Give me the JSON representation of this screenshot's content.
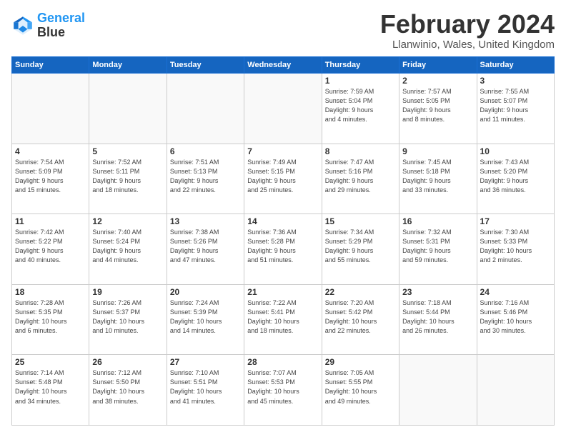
{
  "logo": {
    "line1": "General",
    "line2": "Blue"
  },
  "title": "February 2024",
  "location": "Llanwinio, Wales, United Kingdom",
  "days_of_week": [
    "Sunday",
    "Monday",
    "Tuesday",
    "Wednesday",
    "Thursday",
    "Friday",
    "Saturday"
  ],
  "weeks": [
    [
      {
        "day": "",
        "info": ""
      },
      {
        "day": "",
        "info": ""
      },
      {
        "day": "",
        "info": ""
      },
      {
        "day": "",
        "info": ""
      },
      {
        "day": "1",
        "info": "Sunrise: 7:59 AM\nSunset: 5:04 PM\nDaylight: 9 hours\nand 4 minutes."
      },
      {
        "day": "2",
        "info": "Sunrise: 7:57 AM\nSunset: 5:05 PM\nDaylight: 9 hours\nand 8 minutes."
      },
      {
        "day": "3",
        "info": "Sunrise: 7:55 AM\nSunset: 5:07 PM\nDaylight: 9 hours\nand 11 minutes."
      }
    ],
    [
      {
        "day": "4",
        "info": "Sunrise: 7:54 AM\nSunset: 5:09 PM\nDaylight: 9 hours\nand 15 minutes."
      },
      {
        "day": "5",
        "info": "Sunrise: 7:52 AM\nSunset: 5:11 PM\nDaylight: 9 hours\nand 18 minutes."
      },
      {
        "day": "6",
        "info": "Sunrise: 7:51 AM\nSunset: 5:13 PM\nDaylight: 9 hours\nand 22 minutes."
      },
      {
        "day": "7",
        "info": "Sunrise: 7:49 AM\nSunset: 5:15 PM\nDaylight: 9 hours\nand 25 minutes."
      },
      {
        "day": "8",
        "info": "Sunrise: 7:47 AM\nSunset: 5:16 PM\nDaylight: 9 hours\nand 29 minutes."
      },
      {
        "day": "9",
        "info": "Sunrise: 7:45 AM\nSunset: 5:18 PM\nDaylight: 9 hours\nand 33 minutes."
      },
      {
        "day": "10",
        "info": "Sunrise: 7:43 AM\nSunset: 5:20 PM\nDaylight: 9 hours\nand 36 minutes."
      }
    ],
    [
      {
        "day": "11",
        "info": "Sunrise: 7:42 AM\nSunset: 5:22 PM\nDaylight: 9 hours\nand 40 minutes."
      },
      {
        "day": "12",
        "info": "Sunrise: 7:40 AM\nSunset: 5:24 PM\nDaylight: 9 hours\nand 44 minutes."
      },
      {
        "day": "13",
        "info": "Sunrise: 7:38 AM\nSunset: 5:26 PM\nDaylight: 9 hours\nand 47 minutes."
      },
      {
        "day": "14",
        "info": "Sunrise: 7:36 AM\nSunset: 5:28 PM\nDaylight: 9 hours\nand 51 minutes."
      },
      {
        "day": "15",
        "info": "Sunrise: 7:34 AM\nSunset: 5:29 PM\nDaylight: 9 hours\nand 55 minutes."
      },
      {
        "day": "16",
        "info": "Sunrise: 7:32 AM\nSunset: 5:31 PM\nDaylight: 9 hours\nand 59 minutes."
      },
      {
        "day": "17",
        "info": "Sunrise: 7:30 AM\nSunset: 5:33 PM\nDaylight: 10 hours\nand 2 minutes."
      }
    ],
    [
      {
        "day": "18",
        "info": "Sunrise: 7:28 AM\nSunset: 5:35 PM\nDaylight: 10 hours\nand 6 minutes."
      },
      {
        "day": "19",
        "info": "Sunrise: 7:26 AM\nSunset: 5:37 PM\nDaylight: 10 hours\nand 10 minutes."
      },
      {
        "day": "20",
        "info": "Sunrise: 7:24 AM\nSunset: 5:39 PM\nDaylight: 10 hours\nand 14 minutes."
      },
      {
        "day": "21",
        "info": "Sunrise: 7:22 AM\nSunset: 5:41 PM\nDaylight: 10 hours\nand 18 minutes."
      },
      {
        "day": "22",
        "info": "Sunrise: 7:20 AM\nSunset: 5:42 PM\nDaylight: 10 hours\nand 22 minutes."
      },
      {
        "day": "23",
        "info": "Sunrise: 7:18 AM\nSunset: 5:44 PM\nDaylight: 10 hours\nand 26 minutes."
      },
      {
        "day": "24",
        "info": "Sunrise: 7:16 AM\nSunset: 5:46 PM\nDaylight: 10 hours\nand 30 minutes."
      }
    ],
    [
      {
        "day": "25",
        "info": "Sunrise: 7:14 AM\nSunset: 5:48 PM\nDaylight: 10 hours\nand 34 minutes."
      },
      {
        "day": "26",
        "info": "Sunrise: 7:12 AM\nSunset: 5:50 PM\nDaylight: 10 hours\nand 38 minutes."
      },
      {
        "day": "27",
        "info": "Sunrise: 7:10 AM\nSunset: 5:51 PM\nDaylight: 10 hours\nand 41 minutes."
      },
      {
        "day": "28",
        "info": "Sunrise: 7:07 AM\nSunset: 5:53 PM\nDaylight: 10 hours\nand 45 minutes."
      },
      {
        "day": "29",
        "info": "Sunrise: 7:05 AM\nSunset: 5:55 PM\nDaylight: 10 hours\nand 49 minutes."
      },
      {
        "day": "",
        "info": ""
      },
      {
        "day": "",
        "info": ""
      }
    ]
  ]
}
